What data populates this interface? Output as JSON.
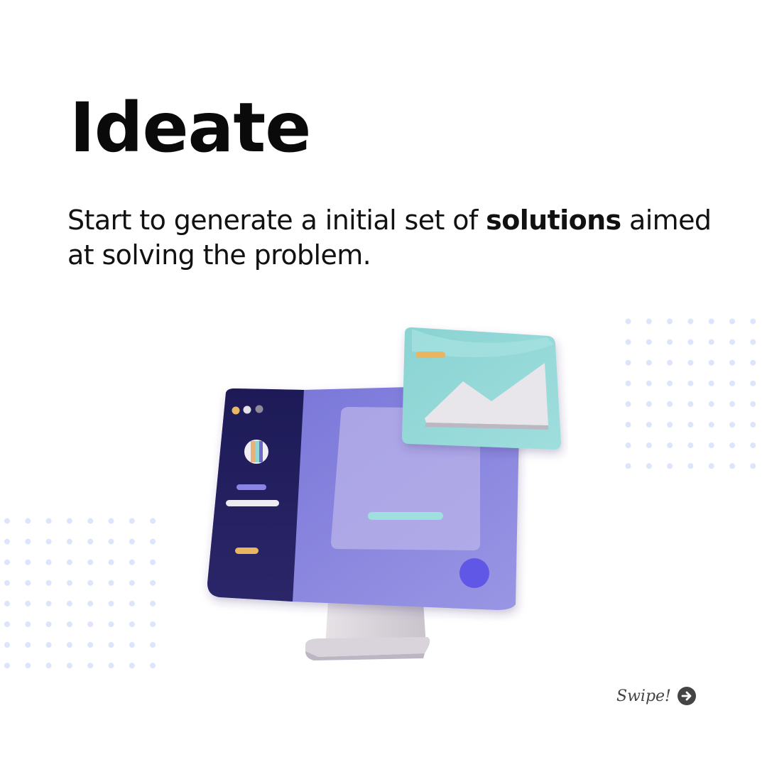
{
  "slide": {
    "title": "Ideate",
    "subtitle_before": "Start to generate a initial set of ",
    "subtitle_bold": "solutions",
    "subtitle_after": " aimed at solving the problem."
  },
  "swipe": {
    "label": "Swipe!",
    "icon": "arrow-right-circle-icon"
  },
  "colors": {
    "dots": "#dce5fb",
    "monitor_sidebar": "#1e1b5a",
    "monitor_screen": "#8b86e0",
    "photo_card": "#8fd6d4",
    "accent_button": "#6157e6",
    "swipe_icon": "#444444"
  }
}
